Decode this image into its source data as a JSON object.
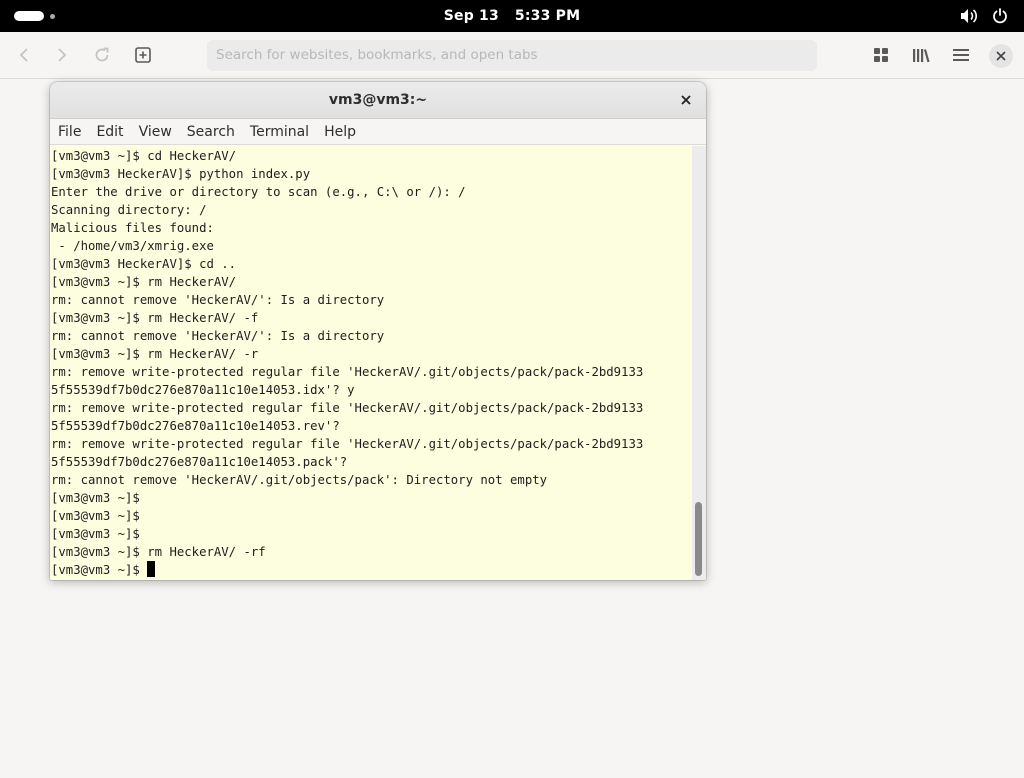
{
  "topbar": {
    "date": "Sep 13",
    "time": "5:33 PM",
    "icons": [
      "activities-pill-icon",
      "volume-icon",
      "power-icon"
    ]
  },
  "browser": {
    "search_placeholder": "Search for websites, bookmarks, and open tabs",
    "icons": [
      "back-arrow-icon",
      "forward-arrow-icon",
      "reload-icon",
      "new-tab-icon",
      "tab-overview-icon",
      "library-icon",
      "hamburger-menu-icon",
      "close-icon"
    ]
  },
  "terminal": {
    "title": "vm3@vm3:~",
    "menu": [
      "File",
      "Edit",
      "View",
      "Search",
      "Terminal",
      "Help"
    ],
    "lines": [
      "[vm3@vm3 ~]$ cd HeckerAV/",
      "[vm3@vm3 HeckerAV]$ python index.py",
      "Enter the drive or directory to scan (e.g., C:\\ or /): /",
      "Scanning directory: /",
      "Malicious files found:",
      " - /home/vm3/xmrig.exe",
      "[vm3@vm3 HeckerAV]$ cd ..",
      "[vm3@vm3 ~]$ rm HeckerAV/",
      "rm: cannot remove 'HeckerAV/': Is a directory",
      "[vm3@vm3 ~]$ rm HeckerAV/ -f",
      "rm: cannot remove 'HeckerAV/': Is a directory",
      "[vm3@vm3 ~]$ rm HeckerAV/ -r",
      "rm: remove write-protected regular file 'HeckerAV/.git/objects/pack/pack-2bd9133",
      "5f55539df7b0dc276e870a11c10e14053.idx'? y",
      "rm: remove write-protected regular file 'HeckerAV/.git/objects/pack/pack-2bd9133",
      "5f55539df7b0dc276e870a11c10e14053.rev'?",
      "rm: remove write-protected regular file 'HeckerAV/.git/objects/pack/pack-2bd9133",
      "5f55539df7b0dc276e870a11c10e14053.pack'?",
      "rm: cannot remove 'HeckerAV/.git/objects/pack': Directory not empty",
      "[vm3@vm3 ~]$",
      "[vm3@vm3 ~]$",
      "[vm3@vm3 ~]$",
      "[vm3@vm3 ~]$ rm HeckerAV/ -rf",
      "[vm3@vm3 ~]$ "
    ],
    "colors": {
      "background": "#fdfde0",
      "foreground": "#1e1e1e"
    },
    "scroll_position": 0.82
  }
}
